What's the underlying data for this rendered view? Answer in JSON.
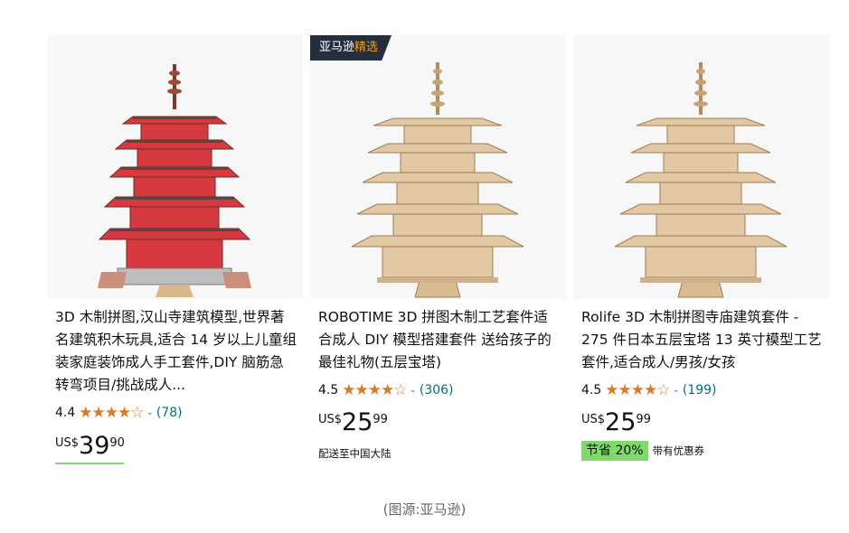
{
  "products": [
    {
      "title": "3D 木制拼图,汉山寺建筑模型,世界著名建筑积木玩具,适合 14 岁以上儿童组装家庭装饰成人手工套件,DIY 脑筋急转弯项目/挑战成人...",
      "rating": "4.4",
      "stars": "★★★★☆",
      "review_count": "(78)",
      "currency": "US$",
      "price_whole": "39",
      "price_fraction": "90",
      "pagoda_color": "red"
    },
    {
      "badge_prefix": "亚马逊",
      "badge_accent": "精选",
      "title": "ROBOTIME 3D 拼图木制工艺套件适合成人 DIY 模型搭建套件 送给孩子的最佳礼物(五层宝塔)",
      "rating": "4.5",
      "stars": "★★★★☆",
      "review_count": "(306)",
      "currency": "US$",
      "price_whole": "25",
      "price_fraction": "99",
      "shipping": "配送至中国大陆",
      "pagoda_color": "wood"
    },
    {
      "title": "Rolife 3D 木制拼图寺庙建筑套件 - 275 件日本五层宝塔 13 英寸模型工艺套件,适合成人/男孩/女孩",
      "rating": "4.5",
      "stars": "★★★★☆",
      "review_count": "(199)",
      "currency": "US$",
      "price_whole": "25",
      "price_fraction": "99",
      "savings": "节省 20%",
      "savings_note": "带有优惠券",
      "pagoda_color": "wood"
    }
  ],
  "chevron": "⌄",
  "caption": "(图源:亚马逊)",
  "colors": {
    "star": "#de7921",
    "link": "#007185",
    "badge_bg": "#232f3e",
    "badge_accent": "#ff9900",
    "save_green": "#7fda69",
    "red_pagoda": "#d63a40",
    "wood": "#e2c9a4"
  }
}
